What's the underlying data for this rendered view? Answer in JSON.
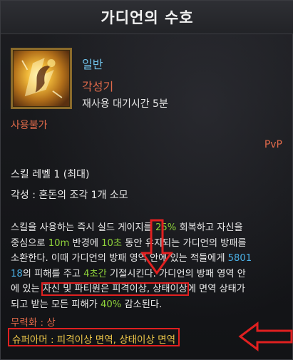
{
  "tooltip": {
    "title": "가디언의 수호",
    "icon": "shield-eagle-icon",
    "grade": "일반",
    "type": "각성기",
    "cooldown": "재사용 대기시간 5분",
    "unusable": "사용불가",
    "pvp": "PvP",
    "level": "스킬 레벨 1 (최대)",
    "awaken_cost": "각성 : 혼돈의 조각 1개 소모",
    "description": {
      "l1a": "스킬을 사용하는 즉시 실드 게이지를 ",
      "l1b": "25%",
      "l1c": " 회복하고 자신을",
      "l2a": "중심으로 ",
      "l2b": "10m",
      "l2c": " 반경에 ",
      "l2d": "10초",
      "l2e": " 동안 유지되는 가디언의 방패를",
      "l3": "소환한다. 이때 가디언의 방패 영역 안에 있는 적들에게 ",
      "l3b": "5801",
      "l4a": "18",
      "l4b": "의 피해를 주고 ",
      "l4c": "4초간",
      "l4d": " 기절시킨다. 가디언의 방패 영역 안",
      "l5a": "에 있는 ",
      "l5b": "자신 및 파티원은 피격이상, 상태이상",
      "l5c": "에 면역 상태가",
      "l6a": "되고 받는 모든 피해가 ",
      "l6b": "40%",
      "l6c": " 감소된다."
    },
    "neutralize": "무력화 : 상",
    "super_armor": "슈퍼아머 : 피격이상 면역, 상태이상 면역"
  },
  "colors": {
    "grade": "#6fc1e8",
    "warning": "#e06a4a",
    "highlight_green": "#8fd33a",
    "highlight_blue": "#4ab0e6",
    "super_armor": "#f0c94a",
    "annotation_red": "#e02020"
  }
}
